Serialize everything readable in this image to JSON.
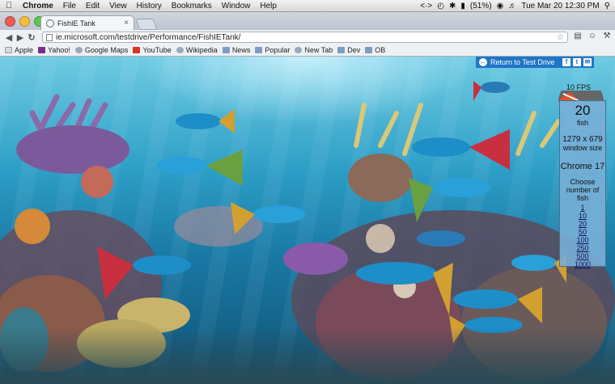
{
  "menubar": {
    "app": "Chrome",
    "items": [
      "File",
      "Edit",
      "View",
      "History",
      "Bookmarks",
      "Window",
      "Help"
    ],
    "battery": "(51%)",
    "clock": "Tue Mar 20  12:30 PM"
  },
  "tab": {
    "title": "FishIE Tank",
    "close": "×"
  },
  "omnibox": {
    "url": "ie.microsoft.com/testdrive/Performance/FishIETank/"
  },
  "bookmarks": [
    {
      "label": "Apple",
      "icon": "page"
    },
    {
      "label": "Yahoo!",
      "icon": "ya"
    },
    {
      "label": "Google Maps",
      "icon": "globe"
    },
    {
      "label": "YouTube",
      "icon": "yt"
    },
    {
      "label": "Wikipedia",
      "icon": "globe"
    },
    {
      "label": "News",
      "icon": "folder"
    },
    {
      "label": "Popular",
      "icon": "folder"
    },
    {
      "label": "New Tab",
      "icon": "globe"
    },
    {
      "label": "Dev",
      "icon": "folder"
    },
    {
      "label": "OB",
      "icon": "folder"
    }
  ],
  "page": {
    "return_link": "Return to Test Drive",
    "fps": "10 FPS",
    "fish_count": "20",
    "fish_label": "fish",
    "window_size": "1279 x 679",
    "window_size_label": "window size",
    "browser": "Chrome 17",
    "choose_label": "Choose number of fish",
    "options": [
      "1",
      "10",
      "20",
      "50",
      "100",
      "250",
      "500",
      "1000"
    ]
  },
  "colors": {
    "accent": "#1f75c6",
    "panel": "#78afd7"
  }
}
